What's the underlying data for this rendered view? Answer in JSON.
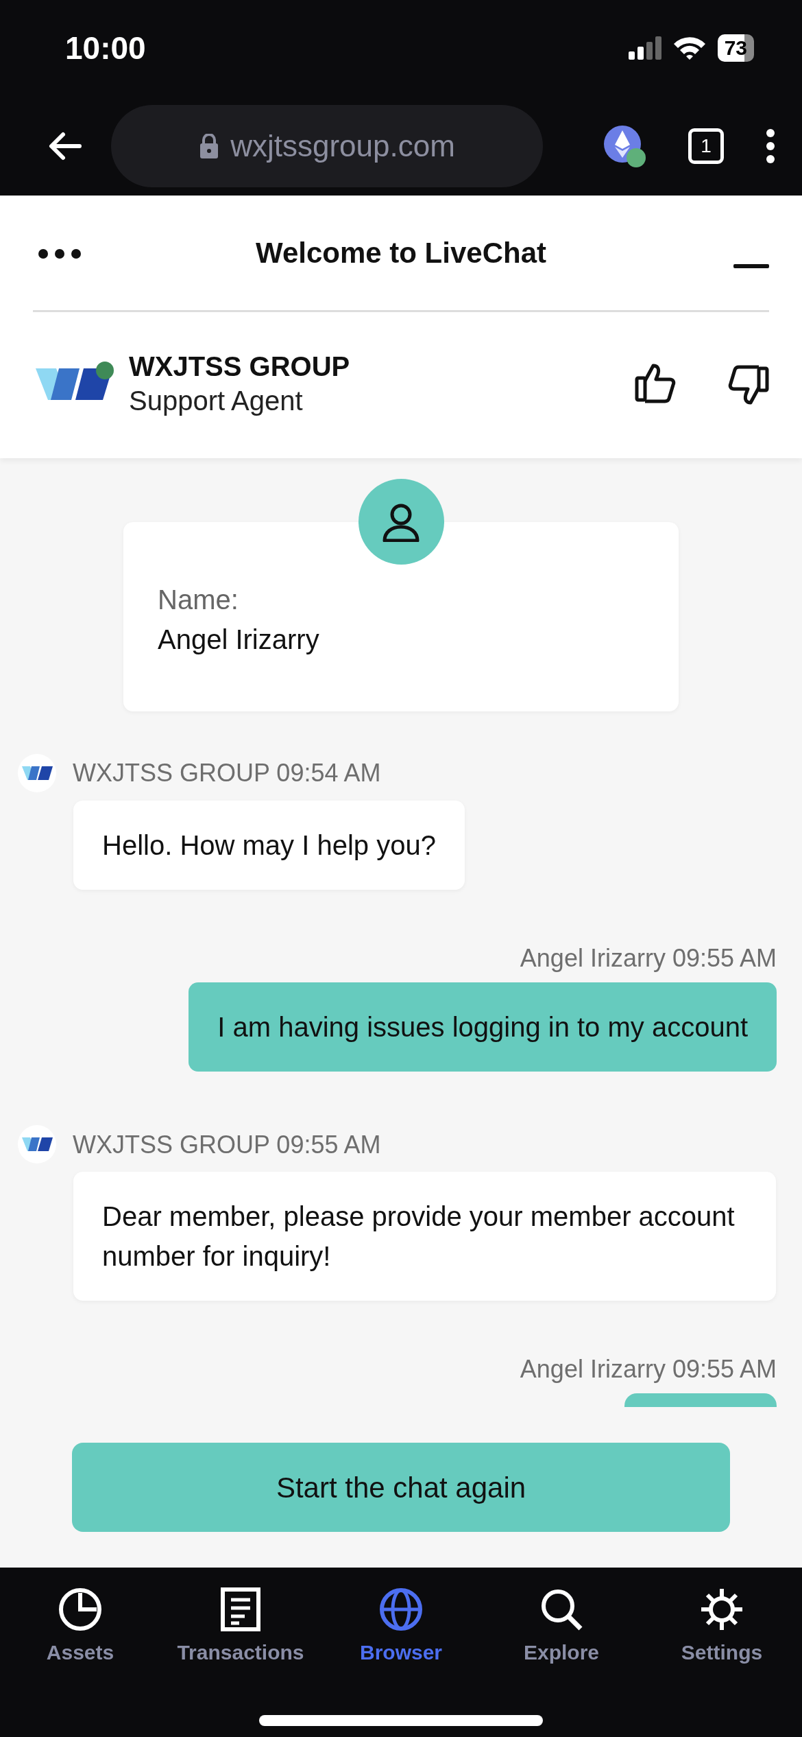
{
  "status_bar": {
    "time": "10:00",
    "battery": "73"
  },
  "browser": {
    "url": "wxjtssgroup.com",
    "tab_count": "1"
  },
  "chat_header": {
    "title": "Welcome to LiveChat"
  },
  "agent": {
    "name": "WXJTSS GROUP",
    "role": "Support Agent",
    "online": true
  },
  "name_card": {
    "label": "Name:",
    "value": "Angel Irizarry"
  },
  "messages": [
    {
      "kind": "agent",
      "sender": "WXJTSS GROUP",
      "time": "09:54 AM",
      "text": "Hello. How may I help you?"
    },
    {
      "kind": "user",
      "sender": "Angel Irizarry",
      "time": "09:55 AM",
      "text": "I am having issues logging in to my account"
    },
    {
      "kind": "agent",
      "sender": "WXJTSS GROUP",
      "time": "09:55 AM",
      "text": "Dear member, please provide your member account number for inquiry!"
    },
    {
      "kind": "user",
      "sender": "Angel Irizarry",
      "time": "09:55 AM"
    }
  ],
  "restart_button": "Start the chat again",
  "nav": [
    {
      "kind": "assets",
      "label": "Assets",
      "selected": false
    },
    {
      "kind": "transactions",
      "label": "Transactions",
      "selected": false
    },
    {
      "kind": "browser",
      "label": "Browser",
      "selected": true
    },
    {
      "kind": "explore",
      "label": "Explore",
      "selected": false
    },
    {
      "kind": "settings",
      "label": "Settings",
      "selected": false
    }
  ]
}
